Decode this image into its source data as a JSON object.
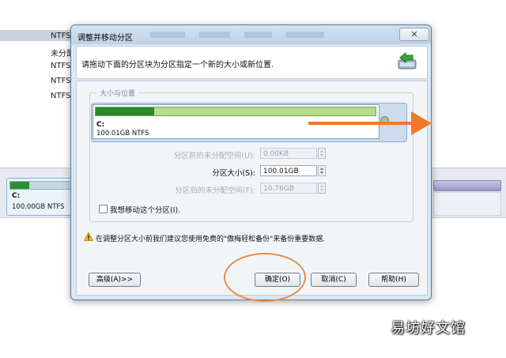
{
  "background": {
    "partition_rows": [
      "NTFS",
      "未分配",
      "NTFS",
      "NTFS",
      "NTFS"
    ],
    "disk_card": {
      "letter": "C:",
      "size": "100.00GB NTFS"
    }
  },
  "dialog": {
    "title": "调整并移动分区",
    "close_label": "✕",
    "instruction": "请拖动下面的分区块为分区指定一个新的大小或新位置.",
    "group_title": "大小与位置",
    "partition": {
      "letter": "C:",
      "size": "100.01GB NTFS",
      "used_fraction": 0.21
    },
    "fields": {
      "before": {
        "label": "分区前的未分配空间(U):",
        "value": "0.00KB"
      },
      "size": {
        "label": "分区大小(S):",
        "value": "100.01GB"
      },
      "after": {
        "label": "分区后的未分配空间(F):",
        "value": "10.76GB"
      }
    },
    "move_checkbox_label": "我想移动这个分区(I).",
    "warning": "在调整分区大小前我们建议您使用免费的\"傲梅轻松备份\"来备份重要数据.",
    "buttons": {
      "advanced": "高级(A)>>",
      "ok": "确定(O)",
      "cancel": "取消(C)",
      "help": "帮助(H)"
    }
  },
  "annotation": {
    "color": "#f0782a"
  },
  "watermark": "易坊好文馆"
}
